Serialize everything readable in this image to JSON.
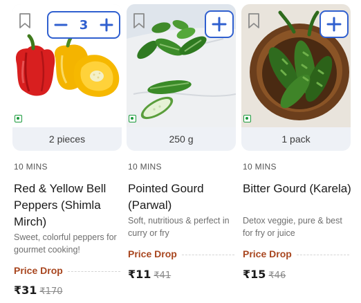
{
  "products": [
    {
      "name": "Red & Yellow Bell Peppers (Shimla Mirch)",
      "quantity": "2 pieces",
      "eta": "10 MINS",
      "description": "Sweet, colorful peppers for gourmet cooking!",
      "badge": "Price Drop",
      "price": "₹31",
      "mrp": "₹170",
      "cart_count": "3",
      "image": "bell-peppers-photo"
    },
    {
      "name": "Pointed Gourd (Parwal)",
      "quantity": "250 g",
      "eta": "10 MINS",
      "description": "Soft, nutritious & perfect in curry or fry",
      "badge": "Price Drop",
      "price": "₹11",
      "mrp": "₹41",
      "image": "pointed-gourd-photo"
    },
    {
      "name": "Bitter Gourd (Karela)",
      "quantity": "1 pack",
      "eta": "10 MINS",
      "description": "Detox veggie, pure & best for fry or juice",
      "badge": "Price Drop",
      "price": "₹15",
      "mrp": "₹46",
      "image": "bitter-gourd-photo"
    }
  ],
  "icons": {
    "bookmark": "bookmark-icon",
    "add": "plus-icon",
    "remove": "minus-icon",
    "veg": "veg-indicator-icon"
  },
  "colors": {
    "accent": "#2f5fcf",
    "price_drop": "#a8461f",
    "veg": "#1a9a3b",
    "card_bg": "#eef1f6"
  }
}
